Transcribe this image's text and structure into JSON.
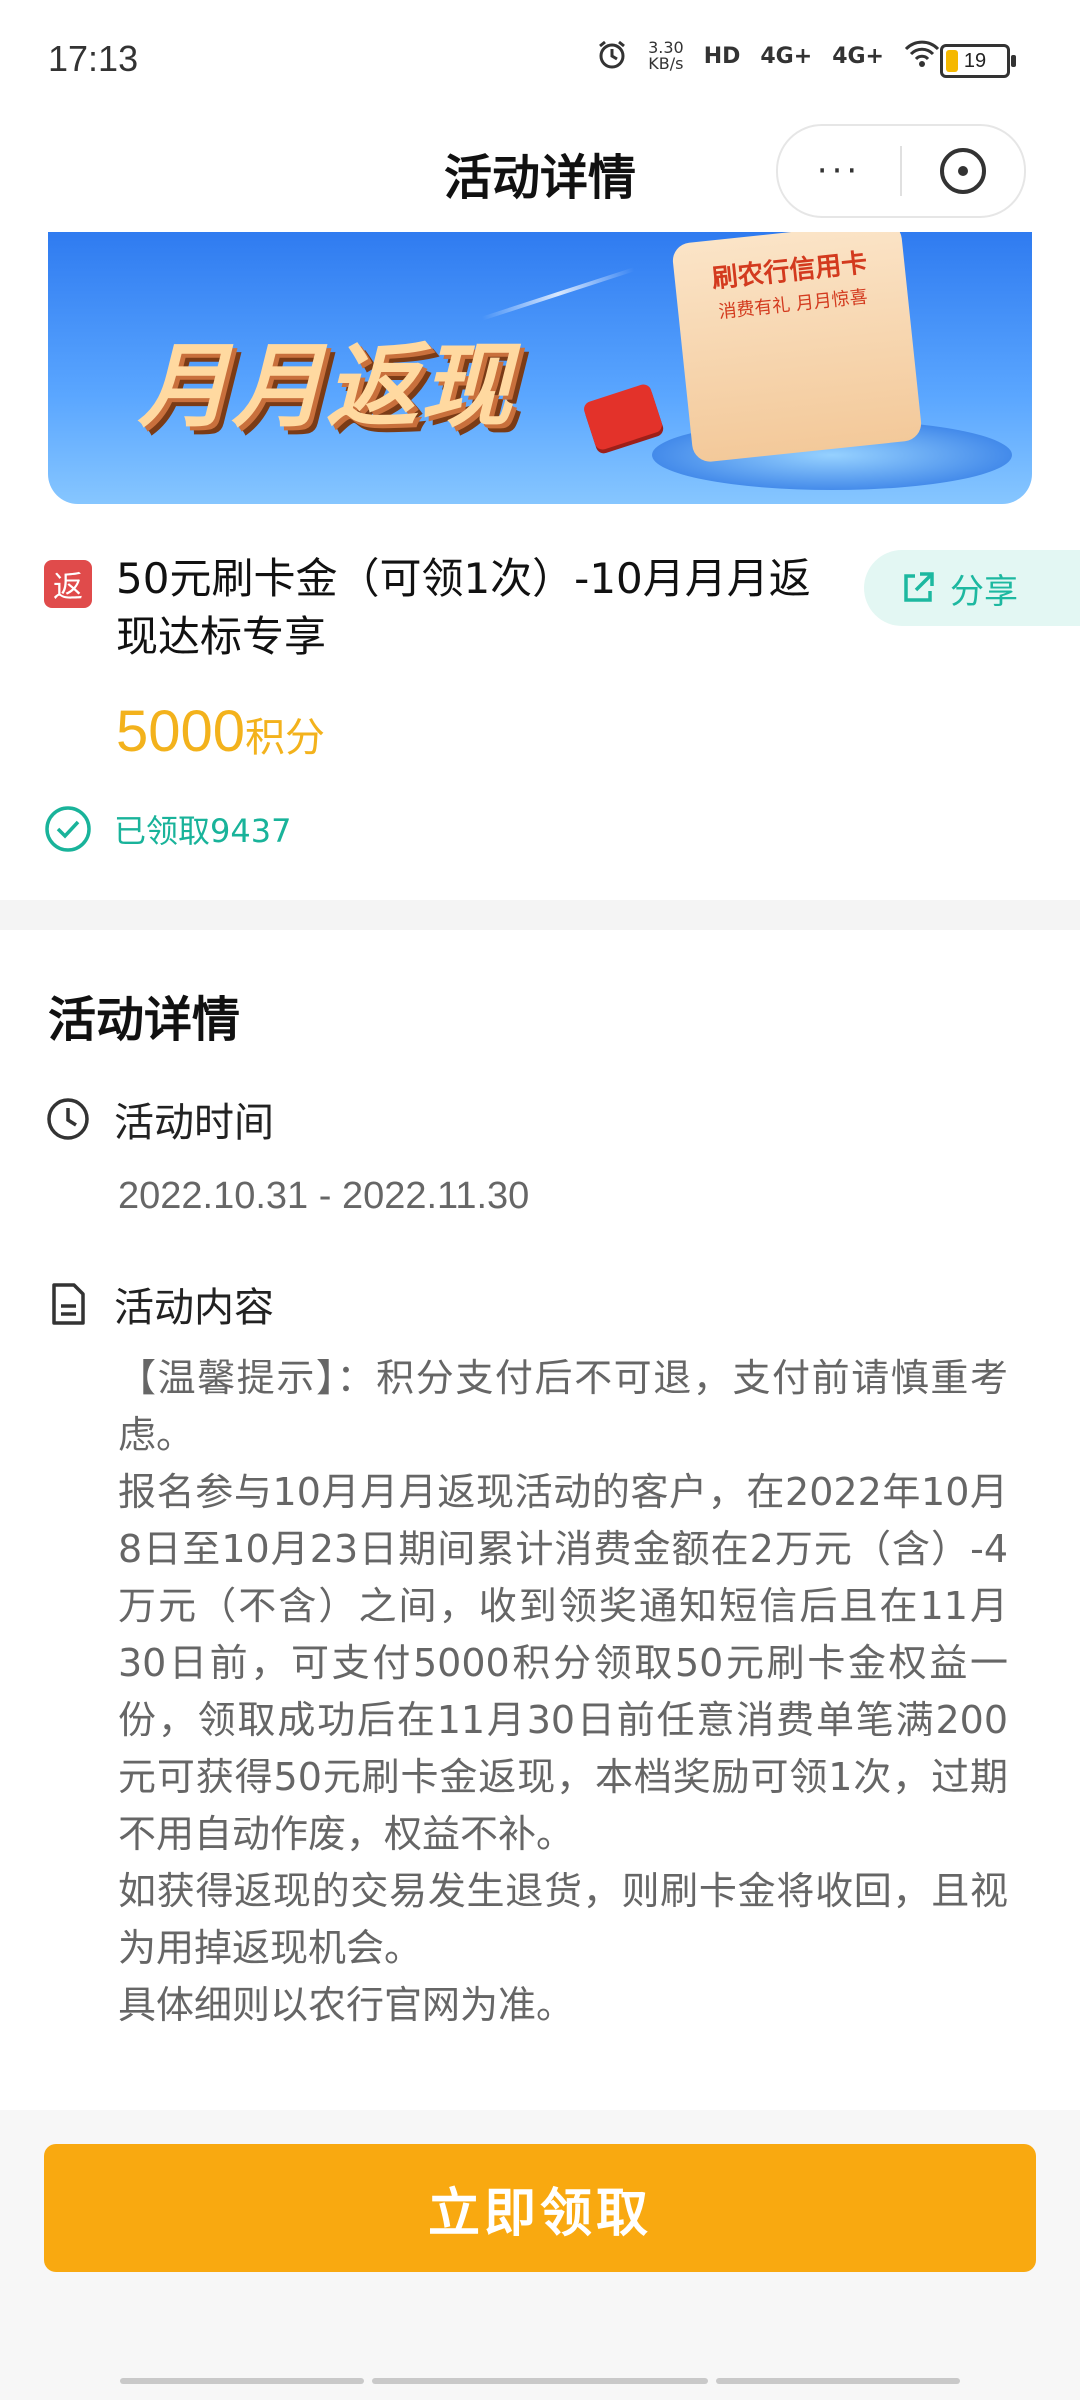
{
  "status_bar": {
    "time": "17:13",
    "net_speed_value": "3.30",
    "net_speed_unit": "KB/s",
    "hd_label": "HD",
    "sim1": "4G+",
    "sim2": "4G+",
    "battery_level": "19"
  },
  "navbar": {
    "title": "活动详情",
    "more_label": "···"
  },
  "banner": {
    "title": "月月返现",
    "scroll_title": "刷农行信用卡",
    "scroll_sub": "消费有礼 月月惊喜"
  },
  "product": {
    "tag": "返",
    "title": "50元刷卡金（可领1次）-10月月月返现达标专享",
    "share_label": "分享",
    "price_value": "5000",
    "price_unit": "积分",
    "claimed_text": "已领取9437"
  },
  "details": {
    "section_title": "活动详情",
    "time_label": "活动时间",
    "time_value": "2022.10.31 - 2022.11.30",
    "content_label": "活动内容",
    "paragraphs": [
      "【温馨提示】：积分支付后不可退，支付前请慎重考虑。",
      "报名参与10月月月返现活动的客户，在2022年10月8日至10月23日期间累计消费金额在2万元（含）-4万元（不含）之间，收到领奖通知短信后且在11月30日前，可支付5000积分领取50元刷卡金权益一份，领取成功后在11月30日前任意消费单笔满200元可获得50元刷卡金返现，本档奖励可领1次，过期不用自动作废，权益不补。",
      "如获得返现的交易发生退货，则刷卡金将收回，且视为用掉返现机会。",
      "具体细则以农行官网为准。"
    ]
  },
  "cta": {
    "label": "立即领取"
  },
  "colors": {
    "accent_orange": "#f9a910",
    "price_gold": "#f3b21c",
    "teal": "#19b39a",
    "tag_red": "#e04b4b"
  }
}
